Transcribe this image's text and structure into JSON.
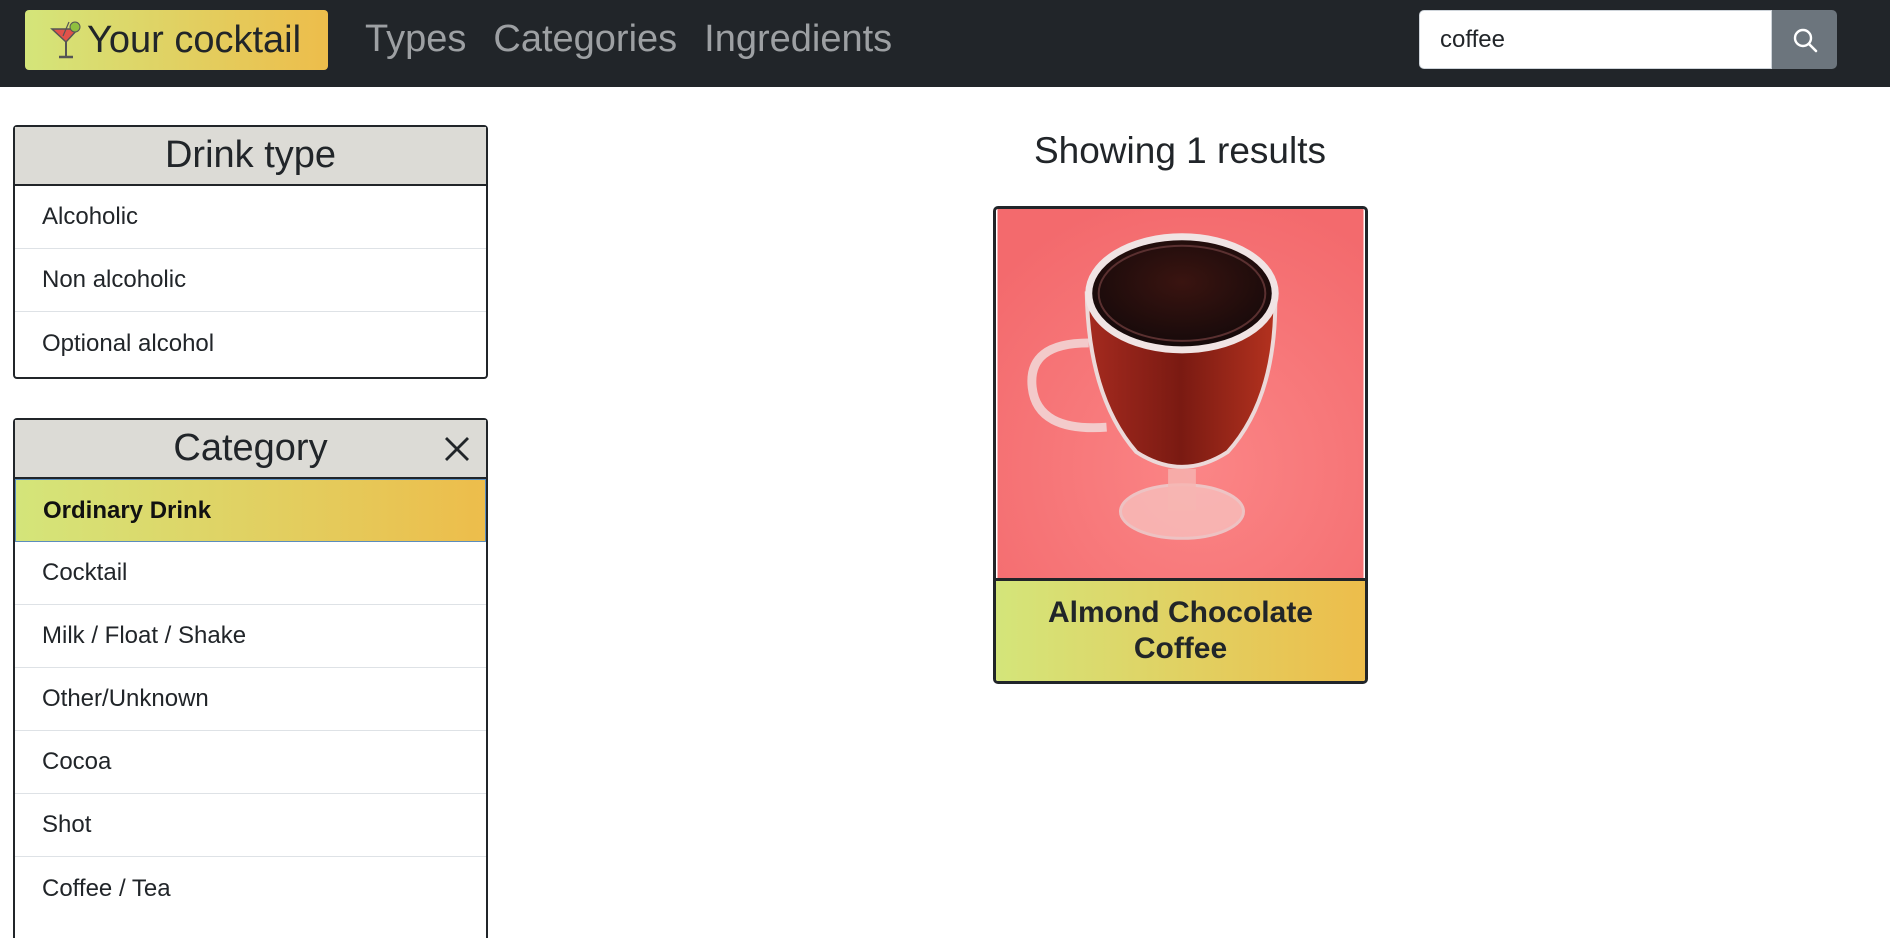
{
  "navbar": {
    "brand_label": "Your cocktail",
    "links": [
      "Types",
      "Categories",
      "Ingredients"
    ],
    "search_value": "coffee"
  },
  "sidebar": {
    "drink_type": {
      "title": "Drink type",
      "items": [
        "Alcoholic",
        "Non alcoholic",
        "Optional alcohol"
      ]
    },
    "category": {
      "title": "Category",
      "selected": "Ordinary Drink",
      "items": [
        "Ordinary Drink",
        "Cocktail",
        "Milk / Float / Shake",
        "Other/Unknown",
        "Cocoa",
        "Shot",
        "Coffee / Tea"
      ]
    }
  },
  "main": {
    "results_label": "Showing 1 results",
    "cards": [
      {
        "name": "Almond Chocolate Coffee",
        "image": "dark-coffee-glass-mug-on-pink"
      }
    ]
  },
  "colors": {
    "navbar_bg": "#212529",
    "accent_gradient_start": "#d4e57a",
    "accent_gradient_end": "#edbd4b",
    "panel_header_bg": "#dcdbd6",
    "search_button": "#6c757d",
    "photo_background": "#f57477"
  },
  "icons": {
    "brand": "cocktail-glass-icon",
    "search": "search-icon",
    "clear_category": "close-icon"
  }
}
